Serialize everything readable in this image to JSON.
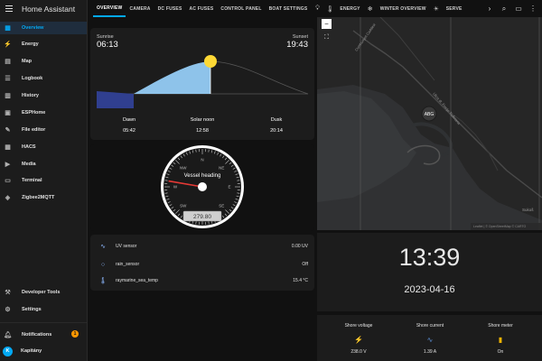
{
  "app": {
    "title": "Home Assistant"
  },
  "sidebar": {
    "items": [
      {
        "label": "Overview",
        "icon": "dashboard-icon"
      },
      {
        "label": "Energy",
        "icon": "lightning-icon"
      },
      {
        "label": "Map",
        "icon": "map-icon"
      },
      {
        "label": "Logbook",
        "icon": "logbook-icon"
      },
      {
        "label": "History",
        "icon": "history-icon"
      },
      {
        "label": "ESPHome",
        "icon": "esphome-icon"
      },
      {
        "label": "File editor",
        "icon": "wrench-icon"
      },
      {
        "label": "HACS",
        "icon": "hacs-icon"
      },
      {
        "label": "Media",
        "icon": "media-icon"
      },
      {
        "label": "Terminal",
        "icon": "terminal-icon"
      },
      {
        "label": "Zigbee2MQTT",
        "icon": "zigbee-icon"
      }
    ],
    "developer_tools": "Developer Tools",
    "settings": "Settings",
    "notifications": "Notifications",
    "notification_count": "1",
    "user_name": "Kapitány",
    "user_initial": "K"
  },
  "tabs": [
    "OVERVIEW",
    "CAMERA",
    "DC FUSES",
    "AC FUSES",
    "CONTROL PANEL",
    "BOAT SETTINGS",
    "ENERGY",
    "WINTER OVERVIEW",
    "SERVE"
  ],
  "sun": {
    "sunrise_label": "Sunrise",
    "sunrise_time": "06:13",
    "sunset_label": "Sunset",
    "sunset_time": "19:43",
    "dawn_label": "Dawn",
    "dawn_time": "05:42",
    "noon_label": "Solar noon",
    "noon_time": "12:58",
    "dusk_label": "Dusk",
    "dusk_time": "20:14"
  },
  "gauge": {
    "title": "Vessel heading",
    "value": "279.80",
    "heading_deg": 279.8,
    "marks": [
      "N",
      "NE",
      "E",
      "SE",
      "S",
      "SW",
      "W",
      "NW"
    ]
  },
  "sensors": [
    {
      "name": "UV sensor",
      "value": "0.00 UV",
      "icon": "wave-icon"
    },
    {
      "name": "rain_sensor",
      "value": "Off",
      "icon": "circle-icon"
    },
    {
      "name": "raymarine_sea_temp",
      "value": "15.4 °C",
      "icon": "thermometer-icon"
    }
  ],
  "map": {
    "marker": "ABG",
    "labels": [
      "Cumhuriyet Caddesi",
      "Ulica dr. Franje Tuđmana",
      "Sukoš"
    ],
    "attribution": "Leaflet | © OpenStreetMap © CARTO",
    "zoom_out": "−"
  },
  "clock": {
    "time": "13:39",
    "date": "2023-04-16"
  },
  "shore": [
    {
      "label": "Shore voltage",
      "value": "238.0 V",
      "icon": "voltage-icon",
      "color": "#5b8fd6"
    },
    {
      "label": "Shore current",
      "value": "1.39 A",
      "icon": "current-icon",
      "color": "#5b8fd6"
    },
    {
      "label": "Shore meter",
      "value": "On",
      "icon": "meter-icon",
      "color": "#f0b400"
    }
  ],
  "colors": {
    "accent": "#03a9f4",
    "sun": "#fdd835",
    "day": "#8ec3ea",
    "night": "#303f8f"
  }
}
